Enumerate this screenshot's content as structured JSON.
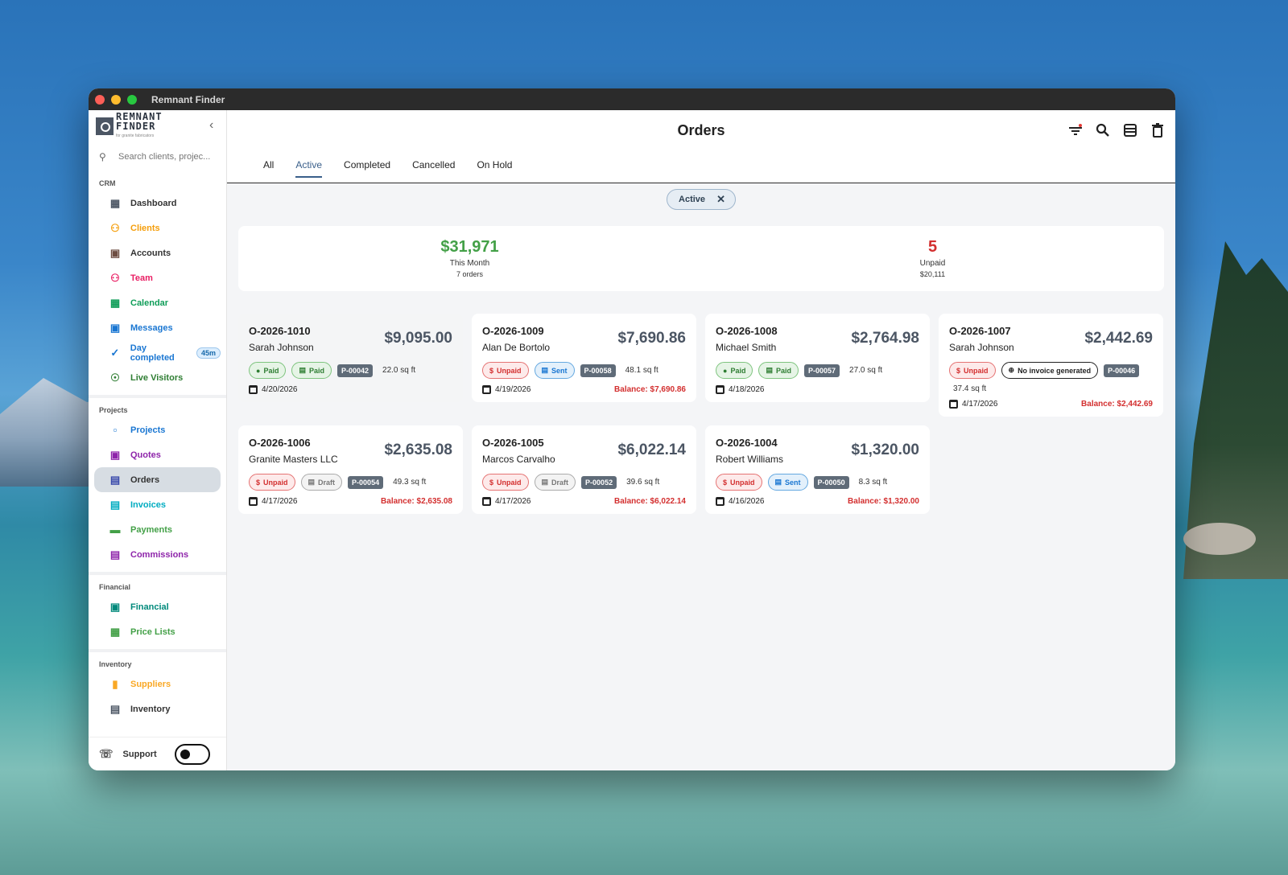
{
  "window": {
    "title": "Remnant Finder"
  },
  "logo": {
    "line1": "REMNANT",
    "line2": "FINDER",
    "tagline": "for granite fabricators"
  },
  "search": {
    "placeholder": "Search clients, projec..."
  },
  "sidebar": {
    "sections": [
      {
        "title": "CRM",
        "items": [
          {
            "label": "Dashboard",
            "icon": "dashboard-icon",
            "color": "#4b5563"
          },
          {
            "label": "Clients",
            "icon": "people-icon",
            "color": "#f59e0b"
          },
          {
            "label": "Accounts",
            "icon": "building-icon",
            "color": "#6d4c41"
          },
          {
            "label": "Team",
            "icon": "team-icon",
            "color": "#e91e63"
          },
          {
            "label": "Calendar",
            "icon": "calendar-icon",
            "color": "#0f9d58"
          },
          {
            "label": "Messages",
            "icon": "chat-icon",
            "color": "#1976d2"
          },
          {
            "label": "Day completed",
            "icon": "check-circle-icon",
            "color": "#1976d2",
            "badge": "45m"
          },
          {
            "label": "Live Visitors",
            "icon": "visitors-icon",
            "color": "#2e7d32"
          }
        ]
      },
      {
        "title": "Projects",
        "items": [
          {
            "label": "Projects",
            "icon": "folder-icon",
            "color": "#1976d2"
          },
          {
            "label": "Quotes",
            "icon": "quote-icon",
            "color": "#8e24aa"
          },
          {
            "label": "Orders",
            "icon": "orders-icon",
            "color": "#3949ab",
            "active": true
          },
          {
            "label": "Invoices",
            "icon": "invoice-icon",
            "color": "#00acc1"
          },
          {
            "label": "Payments",
            "icon": "card-icon",
            "color": "#43a047"
          },
          {
            "label": "Commissions",
            "icon": "commission-icon",
            "color": "#8e24aa"
          }
        ]
      },
      {
        "title": "Financial",
        "items": [
          {
            "label": "Financial",
            "icon": "wallet-icon",
            "color": "#00897b"
          },
          {
            "label": "Price Lists",
            "icon": "list-icon",
            "color": "#43a047"
          }
        ]
      },
      {
        "title": "Inventory",
        "items": [
          {
            "label": "Suppliers",
            "icon": "truck-icon",
            "color": "#f9a825"
          },
          {
            "label": "Inventory",
            "icon": "archive-icon",
            "color": "#4b5563"
          }
        ]
      }
    ],
    "support_label": "Support"
  },
  "header": {
    "title": "Orders"
  },
  "tabs": [
    "All",
    "Active",
    "Completed",
    "Cancelled",
    "On Hold"
  ],
  "active_tab": 1,
  "filter_chip": {
    "label": "Active"
  },
  "summary": {
    "this_month": {
      "value": "$31,971",
      "label": "This Month",
      "sub": "7 orders",
      "color": "#43a047"
    },
    "unpaid": {
      "value": "5",
      "label": "Unpaid",
      "sub": "$20,111",
      "color": "#d32f2f"
    }
  },
  "orders": [
    {
      "id": "O-2026-1010",
      "client": "Sarah Johnson",
      "amount": "$9,095.00",
      "badges": [
        {
          "type": "paid",
          "label": "Paid",
          "icon": "dollar-icon"
        },
        {
          "type": "paid",
          "label": "Paid",
          "icon": "receipt-icon"
        }
      ],
      "project": "P-00042",
      "sqft": "22.0 sq ft",
      "date": "4/20/2026",
      "balance": "",
      "highlight": true
    },
    {
      "id": "O-2026-1009",
      "client": "Alan De Bortolo",
      "amount": "$7,690.86",
      "badges": [
        {
          "type": "unpaid",
          "label": "Unpaid",
          "icon": "no-dollar-icon"
        },
        {
          "type": "sent",
          "label": "Sent",
          "icon": "receipt-icon"
        }
      ],
      "project": "P-00058",
      "sqft": "48.1 sq ft",
      "date": "4/19/2026",
      "balance": "Balance: $7,690.86"
    },
    {
      "id": "O-2026-1008",
      "client": "Michael Smith",
      "amount": "$2,764.98",
      "badges": [
        {
          "type": "paid",
          "label": "Paid",
          "icon": "dollar-icon"
        },
        {
          "type": "paid",
          "label": "Paid",
          "icon": "receipt-icon"
        }
      ],
      "project": "P-00057",
      "sqft": "27.0 sq ft",
      "date": "4/18/2026",
      "balance": ""
    },
    {
      "id": "O-2026-1007",
      "client": "Sarah Johnson",
      "amount": "$2,442.69",
      "badges": [
        {
          "type": "unpaid",
          "label": "Unpaid",
          "icon": "no-dollar-icon"
        },
        {
          "type": "noinv",
          "label": "No invoice generated",
          "icon": "plus-circle-icon"
        }
      ],
      "project": "P-00046",
      "sqft": "37.4 sq ft",
      "date": "4/17/2026",
      "balance": "Balance: $2,442.69"
    },
    {
      "id": "O-2026-1006",
      "client": "Granite Masters LLC",
      "amount": "$2,635.08",
      "badges": [
        {
          "type": "unpaid",
          "label": "Unpaid",
          "icon": "no-dollar-icon"
        },
        {
          "type": "draft",
          "label": "Draft",
          "icon": "receipt-icon"
        }
      ],
      "project": "P-00054",
      "sqft": "49.3 sq ft",
      "date": "4/17/2026",
      "balance": "Balance: $2,635.08"
    },
    {
      "id": "O-2026-1005",
      "client": "Marcos Carvalho",
      "amount": "$6,022.14",
      "badges": [
        {
          "type": "unpaid",
          "label": "Unpaid",
          "icon": "no-dollar-icon"
        },
        {
          "type": "draft",
          "label": "Draft",
          "icon": "receipt-icon"
        }
      ],
      "project": "P-00052",
      "sqft": "39.6 sq ft",
      "date": "4/17/2026",
      "balance": "Balance: $6,022.14"
    },
    {
      "id": "O-2026-1004",
      "client": "Robert Williams",
      "amount": "$1,320.00",
      "badges": [
        {
          "type": "unpaid",
          "label": "Unpaid",
          "icon": "no-dollar-icon"
        },
        {
          "type": "sent",
          "label": "Sent",
          "icon": "receipt-icon"
        }
      ],
      "project": "P-00050",
      "sqft": "8.3 sq ft",
      "date": "4/16/2026",
      "balance": "Balance: $1,320.00"
    }
  ]
}
